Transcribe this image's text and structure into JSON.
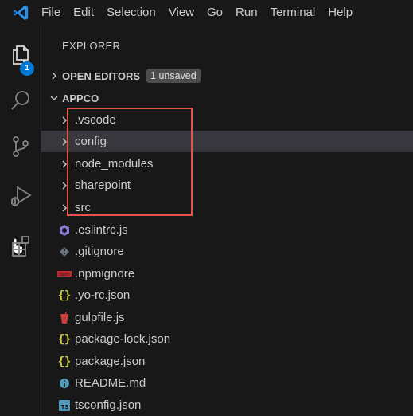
{
  "menu": {
    "items": [
      "File",
      "Edit",
      "Selection",
      "View",
      "Go",
      "Run",
      "Terminal",
      "Help"
    ]
  },
  "activity_bar": {
    "items": [
      {
        "name": "explorer",
        "icon": "files-icon",
        "badge": "1"
      },
      {
        "name": "search",
        "icon": "search-icon"
      },
      {
        "name": "source-control",
        "icon": "source-control-icon"
      },
      {
        "name": "run-and-debug",
        "icon": "run-debug-icon"
      },
      {
        "name": "extensions",
        "icon": "extensions-icon"
      }
    ]
  },
  "explorer": {
    "title": "EXPLORER",
    "open_editors": {
      "label": "OPEN EDITORS",
      "badge": "1 unsaved"
    },
    "workspace": {
      "label": "APPCO"
    },
    "folders": [
      ".vscode",
      "config",
      "node_modules",
      "sharepoint",
      "src"
    ],
    "files": [
      {
        "name": ".eslintrc.js",
        "icon": "eslint-icon"
      },
      {
        "name": ".gitignore",
        "icon": "git-icon"
      },
      {
        "name": ".npmignore",
        "icon": "npm-icon"
      },
      {
        "name": ".yo-rc.json",
        "icon": "json-icon"
      },
      {
        "name": "gulpfile.js",
        "icon": "gulp-icon"
      },
      {
        "name": "package-lock.json",
        "icon": "json-icon"
      },
      {
        "name": "package.json",
        "icon": "json-icon"
      },
      {
        "name": "README.md",
        "icon": "info-icon"
      },
      {
        "name": "tsconfig.json",
        "icon": "typescript-icon"
      }
    ]
  },
  "colors": {
    "accent": "#0078d4",
    "highlight_border": "#e5534b",
    "selection": "#37373d"
  }
}
